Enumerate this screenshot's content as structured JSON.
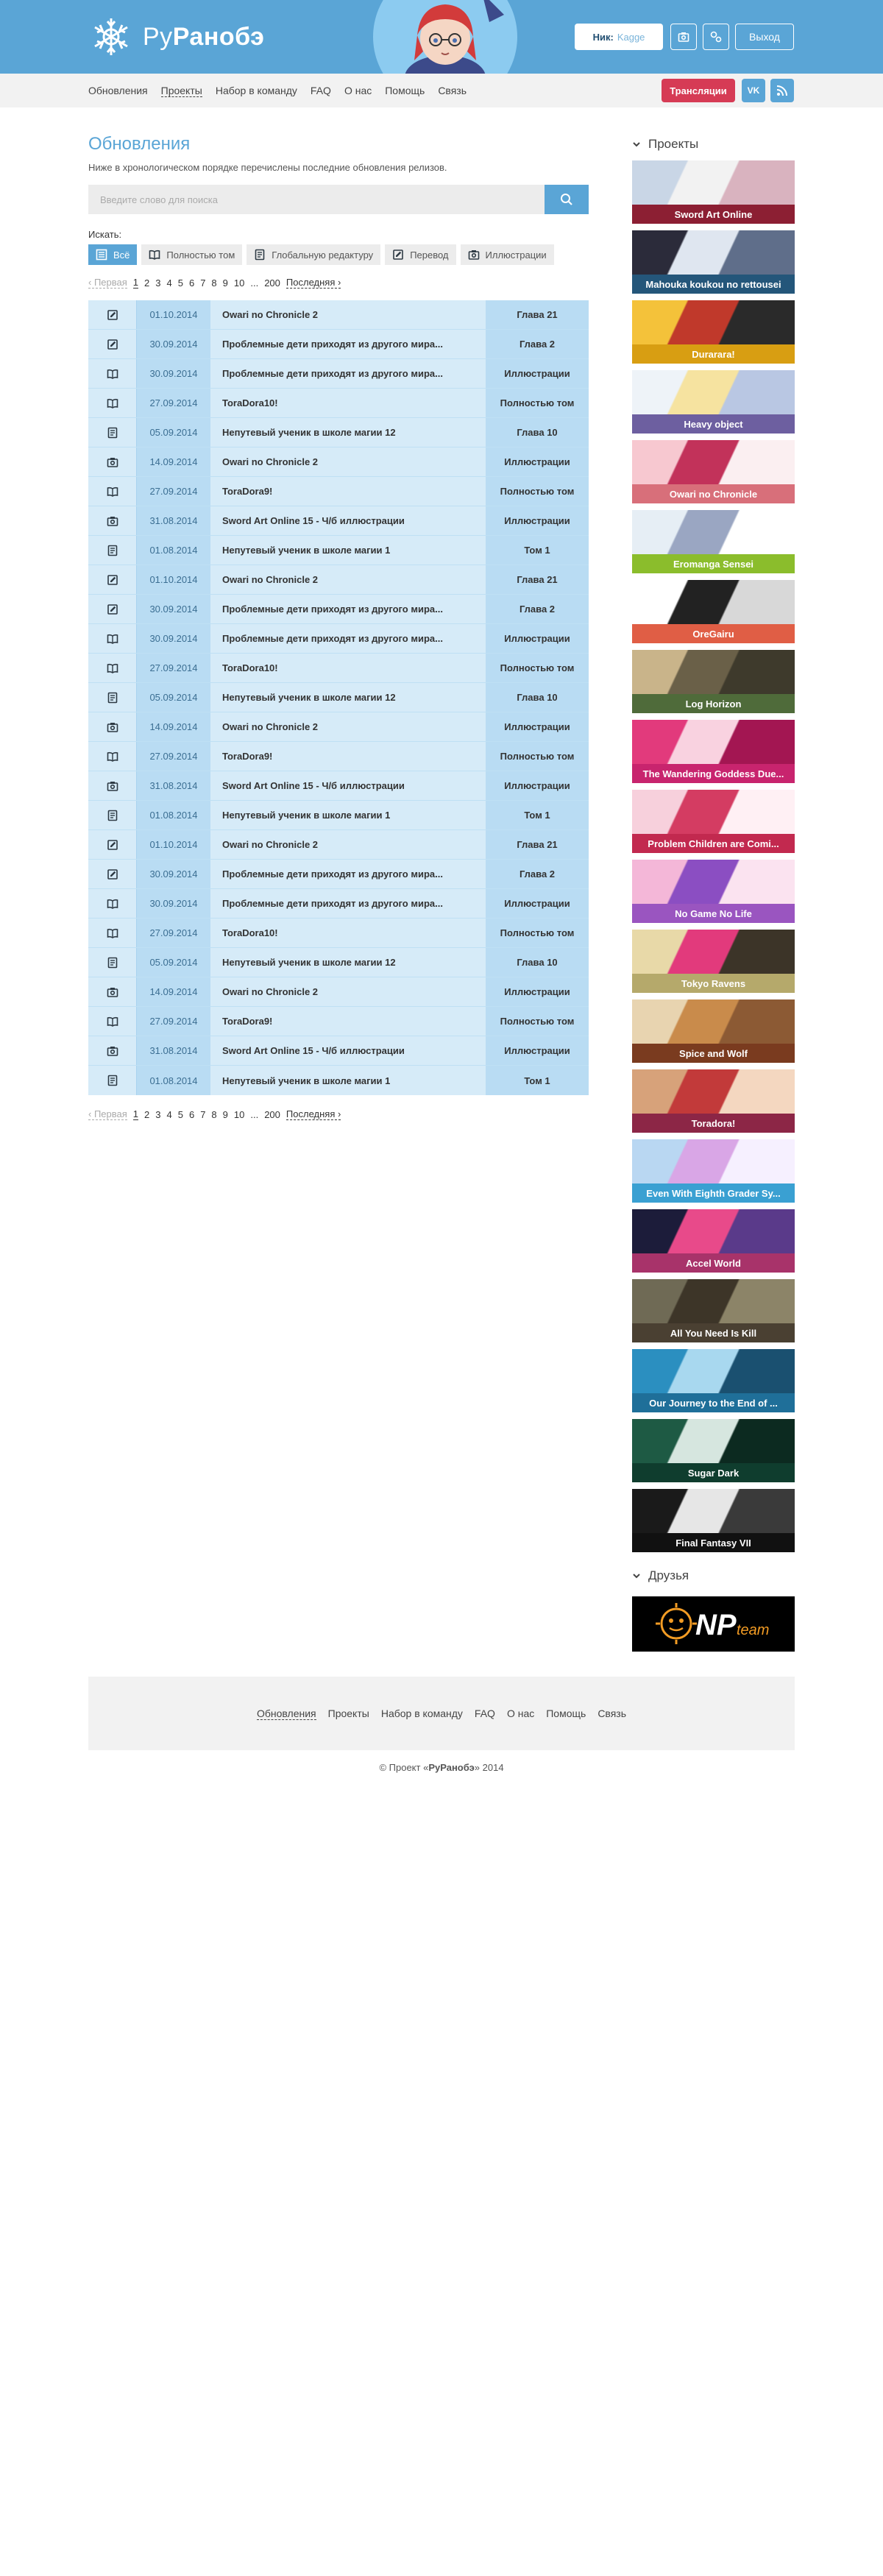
{
  "header": {
    "logo_text_a": "Ру",
    "logo_text_b": "Ранобэ",
    "nick_label": "Ник:",
    "nick_value": "Kagge",
    "logout_label": "Выход"
  },
  "nav": {
    "items": [
      "Обновления",
      "Проекты",
      "Набор в команду",
      "FAQ",
      "О нас",
      "Помощь",
      "Связь"
    ],
    "active": "Проекты",
    "stream_label": "Трансляции",
    "vk_label": "VK"
  },
  "main": {
    "title": "Обновления",
    "description": "Ниже в хронологическом порядке перечислены последние обновления релизов.",
    "search_placeholder": "Введите слово для поиска",
    "filter_label": "Искать:",
    "filters": [
      {
        "label": "Всё",
        "icon": "list-icon",
        "active": true
      },
      {
        "label": "Полностью том",
        "icon": "book-icon",
        "active": false
      },
      {
        "label": "Глобальную редактуру",
        "icon": "document-icon",
        "active": false
      },
      {
        "label": "Перевод",
        "icon": "edit-icon",
        "active": false
      },
      {
        "label": "Иллюстрации",
        "icon": "camera-icon",
        "active": false
      }
    ],
    "pager": {
      "first": "‹ Первая",
      "pages": [
        "1",
        "2",
        "3",
        "4",
        "5",
        "6",
        "7",
        "8",
        "9",
        "10",
        "...",
        "200"
      ],
      "current": "1",
      "last": "Последняя ›"
    },
    "rows": [
      {
        "icon": "edit-icon",
        "date": "01.10.2014",
        "title": "Owari no Chronicle 2",
        "type": "Глава 21"
      },
      {
        "icon": "edit-icon",
        "date": "30.09.2014",
        "title": "Проблемные дети приходят из другого мира...",
        "type": "Глава 2"
      },
      {
        "icon": "book-icon",
        "date": "30.09.2014",
        "title": "Проблемные дети приходят из другого мира...",
        "type": "Иллюстрации"
      },
      {
        "icon": "book-icon",
        "date": "27.09.2014",
        "title": "ToraDora10!",
        "type": "Полностью том"
      },
      {
        "icon": "document-icon",
        "date": "05.09.2014",
        "title": "Непутевый ученик в школе магии 12",
        "type": "Глава 10"
      },
      {
        "icon": "camera-icon",
        "date": "14.09.2014",
        "title": "Owari no Chronicle 2",
        "type": "Иллюстрации"
      },
      {
        "icon": "book-icon",
        "date": "27.09.2014",
        "title": "ToraDora9!",
        "type": "Полностью том"
      },
      {
        "icon": "camera-icon",
        "date": "31.08.2014",
        "title": "Sword Art Online 15 - Ч/б иллюстрации",
        "type": "Иллюстрации"
      },
      {
        "icon": "document-icon",
        "date": "01.08.2014",
        "title": "Непутевый ученик в школе магии 1",
        "type": "Том 1"
      },
      {
        "icon": "edit-icon",
        "date": "01.10.2014",
        "title": "Owari no Chronicle 2",
        "type": "Глава 21"
      },
      {
        "icon": "edit-icon",
        "date": "30.09.2014",
        "title": "Проблемные дети приходят из другого мира...",
        "type": "Глава 2"
      },
      {
        "icon": "book-icon",
        "date": "30.09.2014",
        "title": "Проблемные дети приходят из другого мира...",
        "type": "Иллюстрации"
      },
      {
        "icon": "book-icon",
        "date": "27.09.2014",
        "title": "ToraDora10!",
        "type": "Полностью том"
      },
      {
        "icon": "document-icon",
        "date": "05.09.2014",
        "title": "Непутевый ученик в школе магии 12",
        "type": "Глава 10"
      },
      {
        "icon": "camera-icon",
        "date": "14.09.2014",
        "title": "Owari no Chronicle 2",
        "type": "Иллюстрации"
      },
      {
        "icon": "book-icon",
        "date": "27.09.2014",
        "title": "ToraDora9!",
        "type": "Полностью том"
      },
      {
        "icon": "camera-icon",
        "date": "31.08.2014",
        "title": "Sword Art Online 15 - Ч/б иллюстрации",
        "type": "Иллюстрации"
      },
      {
        "icon": "document-icon",
        "date": "01.08.2014",
        "title": "Непутевый ученик в школе магии 1",
        "type": "Том 1"
      },
      {
        "icon": "edit-icon",
        "date": "01.10.2014",
        "title": "Owari no Chronicle 2",
        "type": "Глава 21"
      },
      {
        "icon": "edit-icon",
        "date": "30.09.2014",
        "title": "Проблемные дети приходят из другого мира...",
        "type": "Глава 2"
      },
      {
        "icon": "book-icon",
        "date": "30.09.2014",
        "title": "Проблемные дети приходят из другого мира...",
        "type": "Иллюстрации"
      },
      {
        "icon": "book-icon",
        "date": "27.09.2014",
        "title": "ToraDora10!",
        "type": "Полностью том"
      },
      {
        "icon": "document-icon",
        "date": "05.09.2014",
        "title": "Непутевый ученик в школе магии 12",
        "type": "Глава 10"
      },
      {
        "icon": "camera-icon",
        "date": "14.09.2014",
        "title": "Owari no Chronicle 2",
        "type": "Иллюстрации"
      },
      {
        "icon": "book-icon",
        "date": "27.09.2014",
        "title": "ToraDora9!",
        "type": "Полностью том"
      },
      {
        "icon": "camera-icon",
        "date": "31.08.2014",
        "title": "Sword Art Online 15 - Ч/б иллюстрации",
        "type": "Иллюстрации"
      },
      {
        "icon": "document-icon",
        "date": "01.08.2014",
        "title": "Непутевый ученик в школе магии 1",
        "type": "Том 1"
      }
    ]
  },
  "sidebar": {
    "projects_title": "Проекты",
    "projects": [
      {
        "name": "Sword Art Online",
        "color": "#8c1f33",
        "art": [
          "#c9d6e6",
          "#f2f2f2",
          "#d9b3bf"
        ]
      },
      {
        "name": "Mahouka koukou no rettousei",
        "color": "#24567a",
        "art": [
          "#2b2b3a",
          "#dfe6f0",
          "#5f6e8a"
        ]
      },
      {
        "name": "Durarara!",
        "color": "#d89e12",
        "art": [
          "#f4c23a",
          "#c0392b",
          "#2a2a2a"
        ]
      },
      {
        "name": "Heavy object",
        "color": "#6d5fa0",
        "art": [
          "#eef3f8",
          "#f6e3a0",
          "#b9c7e3"
        ]
      },
      {
        "name": "Owari no Chronicle",
        "color": "#d86f7a",
        "art": [
          "#f7c8d0",
          "#c2325a",
          "#fbeff1"
        ]
      },
      {
        "name": "Eromanga Sensei",
        "color": "#8bbd2c",
        "art": [
          "#e6eef5",
          "#9aa6c2",
          "#ffffff"
        ]
      },
      {
        "name": "OreGairu",
        "color": "#e05e45",
        "art": [
          "#ffffff",
          "#222222",
          "#d8d8d8"
        ]
      },
      {
        "name": "Log Horizon",
        "color": "#4f6b3a",
        "art": [
          "#c9b48a",
          "#6a6048",
          "#3e3a2c"
        ]
      },
      {
        "name": "The Wandering Goddess Due...",
        "color": "#c8246e",
        "art": [
          "#e23a7c",
          "#f9d2e0",
          "#a31652"
        ]
      },
      {
        "name": "Problem Children are Comi...",
        "color": "#c2294f",
        "art": [
          "#f7d0dc",
          "#d43c62",
          "#fff0f4"
        ]
      },
      {
        "name": "No Game No Life",
        "color": "#9a55c0",
        "art": [
          "#f4b7d8",
          "#8b4ec2",
          "#fbe3f0"
        ]
      },
      {
        "name": "Tokyo Ravens",
        "color": "#b5a96b",
        "art": [
          "#e8d9a8",
          "#e23a7c",
          "#3c3428"
        ]
      },
      {
        "name": "Spice and Wolf",
        "color": "#7a3b1f",
        "art": [
          "#e8d4b0",
          "#c98b4b",
          "#8c5a34"
        ]
      },
      {
        "name": "Toradora!",
        "color": "#8c2646",
        "art": [
          "#d7a27a",
          "#c23a3a",
          "#f4d7c0"
        ]
      },
      {
        "name": "Even With Eighth Grader Sy...",
        "color": "#3aa0d2",
        "art": [
          "#b9d7f2",
          "#d9a6e6",
          "#f6f0ff"
        ]
      },
      {
        "name": "Accel World",
        "color": "#a8336a",
        "art": [
          "#1c1c3a",
          "#e84a8a",
          "#5a3a8a"
        ]
      },
      {
        "name": "All You Need Is Kill",
        "color": "#4a4032",
        "art": [
          "#6f6a55",
          "#3d3528",
          "#8c8468"
        ]
      },
      {
        "name": "Our Journey to the End of ...",
        "color": "#1f6f99",
        "art": [
          "#2b8fc0",
          "#a8d8ef",
          "#1a5070"
        ]
      },
      {
        "name": "Sugar Dark",
        "color": "#0f3d2e",
        "art": [
          "#1e5a44",
          "#d6e6df",
          "#0c2a20"
        ]
      },
      {
        "name": "Final Fantasy VII",
        "color": "#111111",
        "art": [
          "#1a1a1a",
          "#e6e6e6",
          "#3a3a3a"
        ]
      }
    ],
    "friends_title": "Друзья",
    "friend_banner": {
      "text": "NP",
      "subtext": "team"
    }
  },
  "footer": {
    "links": [
      "Обновления",
      "Проекты",
      "Набор в команду",
      "FAQ",
      "О нас",
      "Помощь",
      "Связь"
    ],
    "active": "Обновления",
    "copyright_prefix": "© Проект «",
    "copyright_name": "РуРанобэ",
    "copyright_suffix": "» 2014"
  },
  "colors": {
    "brand_blue": "#5aa5d6",
    "stream_red": "#d63b55",
    "row_light": "#d6ebf8",
    "row_dark": "#b9dcf3"
  }
}
